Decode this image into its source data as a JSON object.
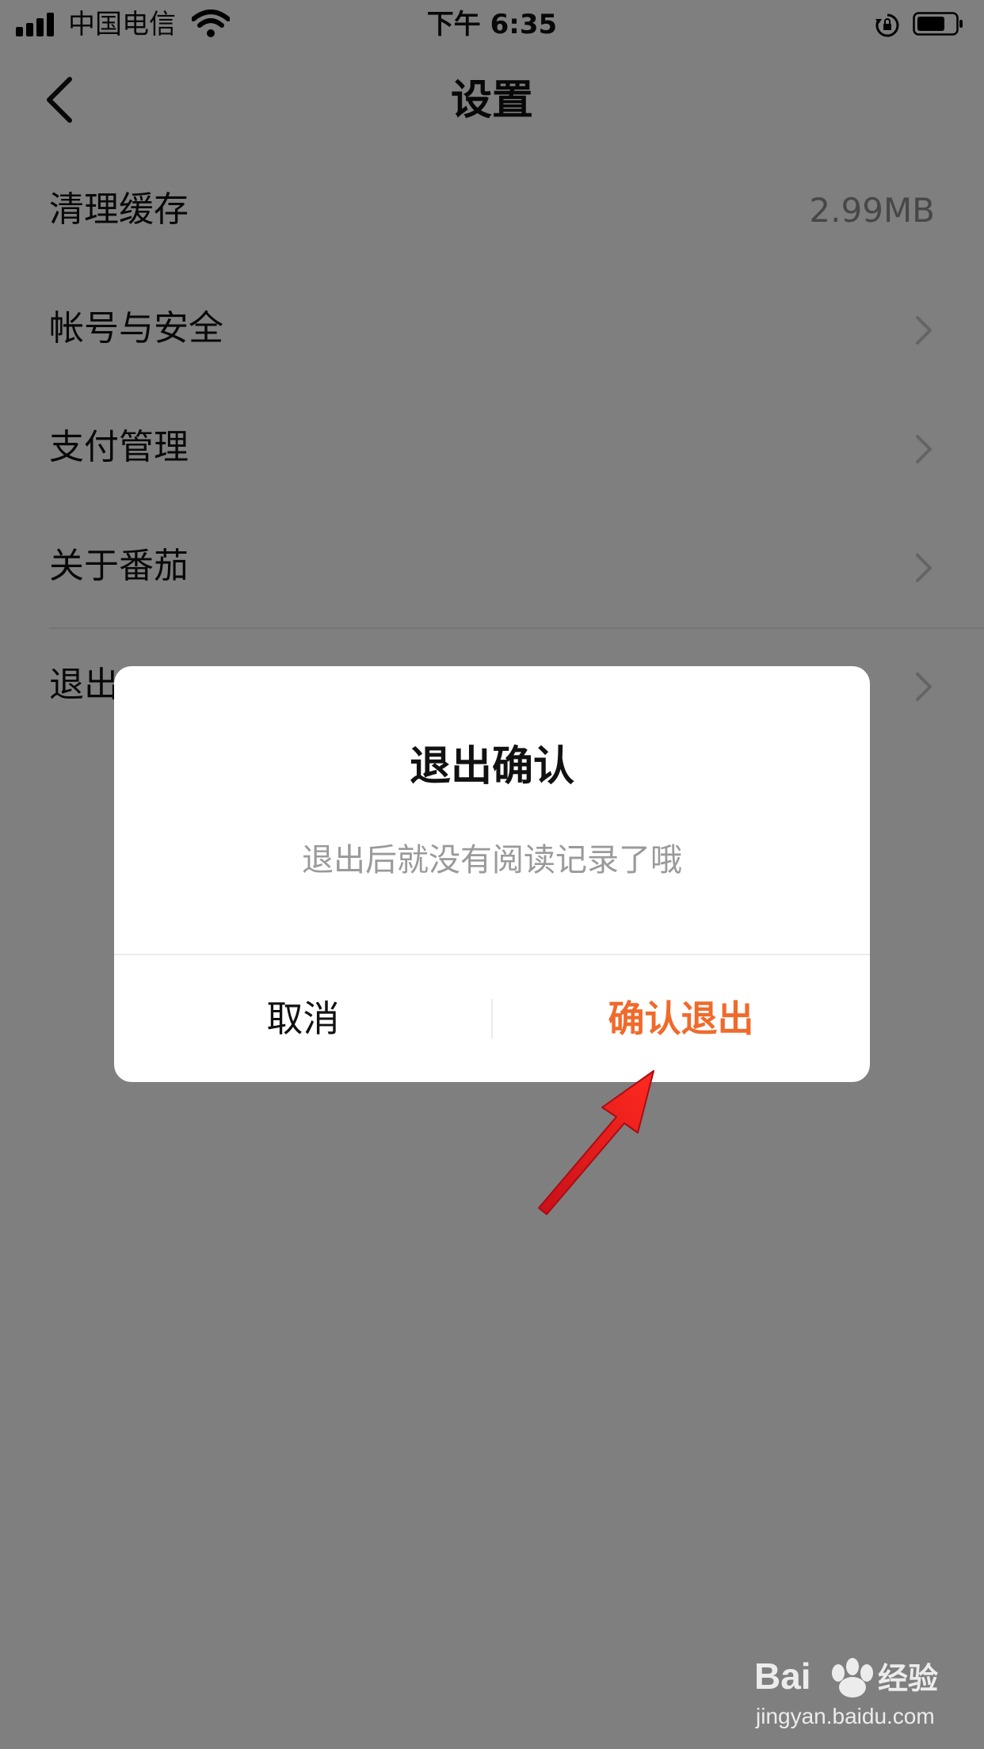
{
  "status_bar": {
    "carrier": "中国电信",
    "time": "下午 6:35",
    "icons": [
      "signal-icon",
      "wifi-icon",
      "rotation-lock-icon",
      "battery-icon"
    ]
  },
  "nav": {
    "title": "设置",
    "back_icon": "chevron-left-icon"
  },
  "settings": {
    "items": [
      {
        "label": "清理缓存",
        "value": "2.99MB"
      },
      {
        "label": "帐号与安全"
      },
      {
        "label": "支付管理"
      },
      {
        "label": "关于番茄"
      },
      {
        "label": "退出"
      }
    ]
  },
  "dialog": {
    "title": "退出确认",
    "message": "退出后就没有阅读记录了哦",
    "cancel_label": "取消",
    "confirm_label": "确认退出"
  },
  "colors": {
    "accent": "#f06a2b",
    "annotation": "#e8201e"
  },
  "watermark": {
    "brand": "Bai",
    "brand_suffix": "经验",
    "url": "jingyan.baidu.com"
  }
}
